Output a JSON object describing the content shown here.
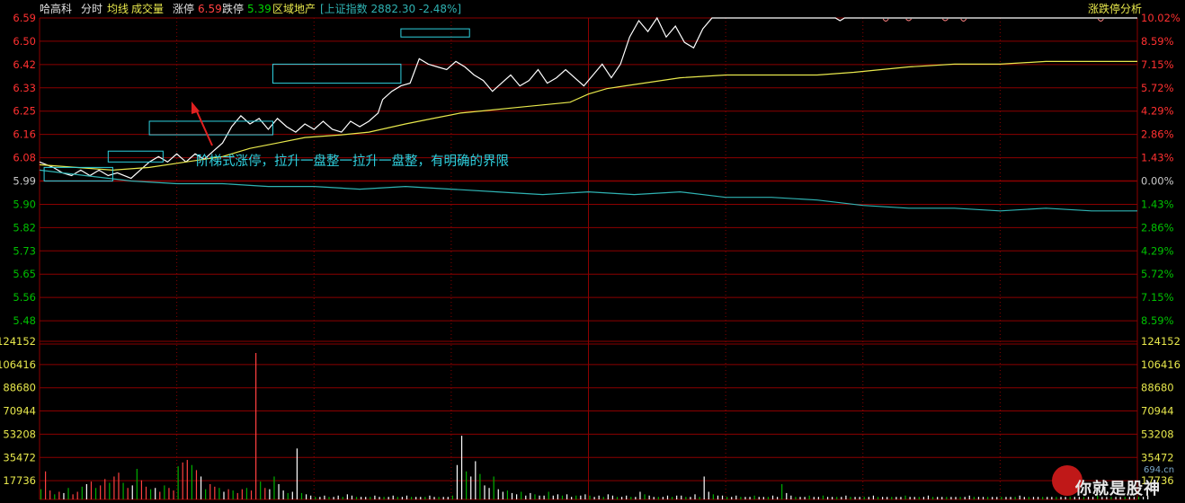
{
  "header": {
    "stock_name": "哈高科",
    "mode_label": "分时",
    "avg_label": "均线",
    "volume_label": "成交量",
    "limit_up_label": "涨停",
    "limit_up_value": "6.59",
    "limit_down_label": "跌停",
    "limit_down_value": "5.39",
    "sector_label": "区域地产",
    "index_text": "[上证指数 2882.30 -2.48%]",
    "analysis_label": "涨跌停分析"
  },
  "annotation": "阶梯式涨停，拉升一盘整一拉升一盘整，有明确的界限",
  "watermark": {
    "text": "你就是股神",
    "sub": "694.cn"
  },
  "colors": {
    "background": "#000000",
    "grid": "#8b0000",
    "price_line": "#ffffff",
    "avg_line": "#e8e84c",
    "index_line": "#2fb3b3",
    "up_axis": "#ff3030",
    "down_axis": "#00c000",
    "neutral": "#c8c8c8",
    "box": "#2fd2e0",
    "arrow": "#e02020"
  },
  "chart_data": {
    "type": "line",
    "title": "",
    "price_axis": {
      "ticks": [
        "6.59",
        "6.50",
        "6.42",
        "6.33",
        "6.25",
        "6.16",
        "6.08",
        "5.99",
        "5.90",
        "5.82",
        "5.73",
        "5.65",
        "5.56",
        "5.48"
      ],
      "prev_close": 5.99,
      "ylim": [
        5.44,
        6.59
      ]
    },
    "pct_axis": {
      "ticks": [
        "10.02%",
        "8.59%",
        "7.15%",
        "5.72%",
        "4.29%",
        "2.86%",
        "1.43%",
        "0.00%",
        "1.43%",
        "2.86%",
        "4.29%",
        "5.72%",
        "7.15%",
        "8.59%"
      ]
    },
    "volume_axis": {
      "ticks": [
        "124152",
        "106416",
        "88680",
        "70944",
        "53208",
        "35472",
        "17736"
      ],
      "ylim": [
        0,
        124152
      ]
    },
    "x_minutes": 240,
    "series": [
      {
        "key": "price",
        "points": [
          [
            0,
            6.06
          ],
          [
            3,
            6.04
          ],
          [
            5,
            6.02
          ],
          [
            7,
            6.01
          ],
          [
            9,
            6.03
          ],
          [
            11,
            6.01
          ],
          [
            13,
            6.03
          ],
          [
            15,
            6.01
          ],
          [
            17,
            6.02
          ],
          [
            20,
            6.0
          ],
          [
            22,
            6.03
          ],
          [
            24,
            6.06
          ],
          [
            26,
            6.08
          ],
          [
            28,
            6.06
          ],
          [
            30,
            6.09
          ],
          [
            32,
            6.06
          ],
          [
            34,
            6.09
          ],
          [
            36,
            6.07
          ],
          [
            38,
            6.1
          ],
          [
            40,
            6.13
          ],
          [
            42,
            6.19
          ],
          [
            44,
            6.23
          ],
          [
            46,
            6.2
          ],
          [
            48,
            6.22
          ],
          [
            50,
            6.18
          ],
          [
            52,
            6.22
          ],
          [
            54,
            6.19
          ],
          [
            56,
            6.17
          ],
          [
            58,
            6.2
          ],
          [
            60,
            6.18
          ],
          [
            62,
            6.21
          ],
          [
            64,
            6.18
          ],
          [
            66,
            6.17
          ],
          [
            68,
            6.21
          ],
          [
            70,
            6.19
          ],
          [
            72,
            6.21
          ],
          [
            74,
            6.24
          ],
          [
            75,
            6.29
          ],
          [
            77,
            6.32
          ],
          [
            79,
            6.34
          ],
          [
            81,
            6.35
          ],
          [
            83,
            6.44
          ],
          [
            85,
            6.42
          ],
          [
            87,
            6.41
          ],
          [
            89,
            6.4
          ],
          [
            91,
            6.43
          ],
          [
            93,
            6.41
          ],
          [
            95,
            6.38
          ],
          [
            97,
            6.36
          ],
          [
            99,
            6.32
          ],
          [
            101,
            6.35
          ],
          [
            103,
            6.38
          ],
          [
            105,
            6.34
          ],
          [
            107,
            6.36
          ],
          [
            109,
            6.4
          ],
          [
            111,
            6.35
          ],
          [
            113,
            6.37
          ],
          [
            115,
            6.4
          ],
          [
            117,
            6.37
          ],
          [
            119,
            6.34
          ],
          [
            121,
            6.38
          ],
          [
            123,
            6.42
          ],
          [
            125,
            6.37
          ],
          [
            127,
            6.42
          ],
          [
            129,
            6.52
          ],
          [
            131,
            6.58
          ],
          [
            133,
            6.54
          ],
          [
            135,
            6.59
          ],
          [
            137,
            6.52
          ],
          [
            139,
            6.56
          ],
          [
            141,
            6.5
          ],
          [
            143,
            6.48
          ],
          [
            145,
            6.55
          ],
          [
            147,
            6.59
          ],
          [
            150,
            6.59
          ],
          [
            155,
            6.59
          ],
          [
            160,
            6.59
          ],
          [
            165,
            6.59
          ],
          [
            170,
            6.59
          ],
          [
            174,
            6.59
          ],
          [
            175,
            6.58
          ],
          [
            176,
            6.59
          ],
          [
            180,
            6.59
          ],
          [
            185,
            6.59
          ],
          [
            190,
            6.59
          ],
          [
            195,
            6.59
          ],
          [
            200,
            6.59
          ],
          [
            210,
            6.59
          ],
          [
            220,
            6.59
          ],
          [
            230,
            6.59
          ],
          [
            240,
            6.59
          ]
        ]
      },
      {
        "key": "average",
        "points": [
          [
            0,
            6.05
          ],
          [
            8,
            6.04
          ],
          [
            16,
            6.03
          ],
          [
            24,
            6.04
          ],
          [
            32,
            6.06
          ],
          [
            40,
            6.08
          ],
          [
            46,
            6.11
          ],
          [
            52,
            6.13
          ],
          [
            58,
            6.15
          ],
          [
            66,
            6.16
          ],
          [
            72,
            6.17
          ],
          [
            80,
            6.2
          ],
          [
            86,
            6.22
          ],
          [
            92,
            6.24
          ],
          [
            98,
            6.25
          ],
          [
            104,
            6.26
          ],
          [
            110,
            6.27
          ],
          [
            116,
            6.28
          ],
          [
            120,
            6.31
          ],
          [
            124,
            6.33
          ],
          [
            128,
            6.34
          ],
          [
            132,
            6.35
          ],
          [
            136,
            6.36
          ],
          [
            140,
            6.37
          ],
          [
            150,
            6.38
          ],
          [
            160,
            6.38
          ],
          [
            170,
            6.38
          ],
          [
            178,
            6.39
          ],
          [
            184,
            6.4
          ],
          [
            190,
            6.41
          ],
          [
            200,
            6.42
          ],
          [
            210,
            6.42
          ],
          [
            220,
            6.43
          ],
          [
            240,
            6.43
          ]
        ]
      },
      {
        "key": "index",
        "points": [
          [
            0,
            6.03
          ],
          [
            10,
            6.01
          ],
          [
            20,
            5.99
          ],
          [
            30,
            5.98
          ],
          [
            40,
            5.98
          ],
          [
            50,
            5.97
          ],
          [
            60,
            5.97
          ],
          [
            70,
            5.96
          ],
          [
            80,
            5.97
          ],
          [
            90,
            5.96
          ],
          [
            100,
            5.95
          ],
          [
            110,
            5.94
          ],
          [
            120,
            5.95
          ],
          [
            130,
            5.94
          ],
          [
            140,
            5.95
          ],
          [
            150,
            5.93
          ],
          [
            160,
            5.93
          ],
          [
            170,
            5.92
          ],
          [
            180,
            5.9
          ],
          [
            190,
            5.89
          ],
          [
            200,
            5.89
          ],
          [
            210,
            5.88
          ],
          [
            220,
            5.89
          ],
          [
            230,
            5.88
          ],
          [
            240,
            5.88
          ]
        ]
      }
    ],
    "volume": [
      8000,
      22000,
      7000,
      4000,
      6000,
      5000,
      9000,
      4000,
      6000,
      10000,
      12000,
      14000,
      9000,
      11000,
      16000,
      13000,
      18000,
      21000,
      13000,
      9000,
      11000,
      24000,
      15000,
      10000,
      8000,
      9000,
      6000,
      11000,
      9000,
      7000,
      26000,
      29000,
      31000,
      27000,
      23000,
      18000,
      8000,
      12000,
      10000,
      9000,
      6000,
      8000,
      7000,
      5000,
      8000,
      9000,
      7000,
      115000,
      14000,
      9000,
      8000,
      18000,
      12000,
      7000,
      5000,
      6000,
      40000,
      5000,
      4000,
      3000,
      2000,
      2000,
      3000,
      2000,
      2000,
      3000,
      2000,
      4000,
      3000,
      2000,
      2000,
      2000,
      2000,
      3000,
      2000,
      2000,
      2000,
      3000,
      2000,
      2000,
      3000,
      2000,
      2000,
      2000,
      2000,
      3000,
      2000,
      2000,
      2000,
      2000,
      3000,
      27000,
      50000,
      22000,
      18000,
      30000,
      20000,
      11000,
      9000,
      18000,
      8000,
      6000,
      7000,
      5000,
      4000,
      6000,
      3000,
      5000,
      4000,
      3000,
      3000,
      6000,
      3000,
      4000,
      3000,
      4000,
      2000,
      3000,
      3000,
      4000,
      3000,
      2000,
      3000,
      2000,
      4000,
      3000,
      2000,
      2000,
      3000,
      2000,
      2000,
      6000,
      4000,
      3000,
      2000,
      2000,
      2000,
      3000,
      2000,
      3000,
      3000,
      2000,
      2000,
      4000,
      2000,
      18000,
      6000,
      4000,
      3000,
      3000,
      2000,
      2000,
      3000,
      2000,
      2000,
      2000,
      3000,
      2000,
      2000,
      2000,
      3000,
      2000,
      12000,
      5000,
      3000,
      2000,
      2000,
      2000,
      3000,
      2000,
      2000,
      3000,
      2000,
      2000,
      2000,
      2000,
      3000,
      2000,
      2000,
      2000,
      2000,
      2000,
      3000,
      2000,
      2000,
      2000,
      2000,
      2000,
      2000,
      3000,
      2000,
      2000,
      2000,
      2000,
      3000,
      2000,
      2000,
      2000,
      2000,
      2000,
      2000,
      2000,
      2000,
      3000,
      2000,
      2000,
      2000,
      2000,
      2000,
      2000,
      2000,
      2000,
      2000,
      2000,
      3000,
      2000,
      2000,
      2000,
      2000,
      2000,
      2000,
      2000,
      2000,
      2000,
      2000,
      2000,
      2000,
      2000,
      2000,
      2000,
      2000,
      3000,
      2000,
      2000,
      2000,
      2000,
      2000,
      2000,
      2000,
      2000,
      2000,
      2000,
      3000
    ],
    "consolidation_boxes": [
      {
        "from_min": 1,
        "to_min": 16,
        "low": 5.99,
        "high": 6.04
      },
      {
        "from_min": 15,
        "to_min": 27,
        "low": 6.06,
        "high": 6.1
      },
      {
        "from_min": 24,
        "to_min": 51,
        "low": 6.16,
        "high": 6.21
      },
      {
        "from_min": 51,
        "to_min": 79,
        "low": 6.35,
        "high": 6.42
      },
      {
        "from_min": 79,
        "to_min": 94,
        "low": 6.52,
        "high": 6.55
      }
    ]
  }
}
